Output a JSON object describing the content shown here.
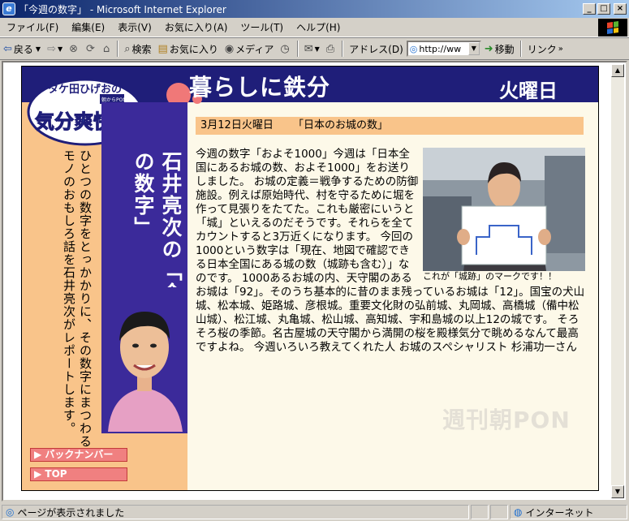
{
  "window": {
    "title": "「今週の数字」 - Microsoft Internet Explorer",
    "controls": {
      "minimize": "_",
      "maximize": "□",
      "close": "×"
    }
  },
  "menubar": {
    "items": [
      "ファイル(F)",
      "編集(E)",
      "表示(V)",
      "お気に入り(A)",
      "ツール(T)",
      "ヘルプ(H)"
    ]
  },
  "toolbar": {
    "back": "戻る",
    "search": "検索",
    "favorites": "お気に入り",
    "media": "メディア",
    "address_label": "アドレス(D)",
    "address_value": "http://ww",
    "go": "移動",
    "links": "リンク"
  },
  "page": {
    "logo_top": "タケ田ひげおの",
    "logo_badge": "朝からPON",
    "logo_main": "気分爽快!!",
    "main_title": "暮らしに鉄分",
    "day": "火曜日",
    "left_text": "ひとつの数字をとっかかりに、その数字にまつわるモノのおもしろ話を石井亮次がレポートします。",
    "name_vertical": "石井亮次の「今週の数字」",
    "nav": {
      "back_number": "▶ バックナンバー",
      "top": "▶ TOP"
    },
    "date": "3月12日火曜日",
    "topic": "「日本のお城の数」",
    "photo_caption": "これが「城跡」のマークです！！",
    "article": "今週の数字「およそ1000」今週は「日本全国にあるお城の数、およそ1000」をお送りしました。 お城の定義＝戦争するための防御施設。例えば原始時代、村を守るために堀を作って見張りをたてた。これも厳密にいうと「城」といえるのだそうです。それらを全てカウントすると3万近くになります。 今回の1000という数字は「現在、地図で確認できる日本全国にある城の数（城跡も含む）」なのです。 1000あるお城の内、天守閣のあるお城は「92」。そのうち基本的に昔のまま残っているお城は「12」。国宝の犬山城、松本城、姫路城、彦根城。重要文化財の弘前城、丸岡城、高橋城（備中松山城）、松江城、丸亀城、松山城、高知城、宇和島城の以上12の城です。 そろそろ桜の季節。名古屋城の天守閣から満開の桜を殿様気分で眺めるなんて最高ですよね。 今週いろいろ教えてくれた人 お城のスペシャリスト 杉浦功一さん",
    "watermark": "週刊朝PON"
  },
  "statusbar": {
    "message": "ページが表示されました",
    "zone": "インターネット"
  },
  "colors": {
    "navy_band": "#1f1e79",
    "purple_col": "#3b2a9a",
    "peach": "#f9c48a",
    "pink_button": "#f08080",
    "page_bg": "#fdf9e9"
  }
}
